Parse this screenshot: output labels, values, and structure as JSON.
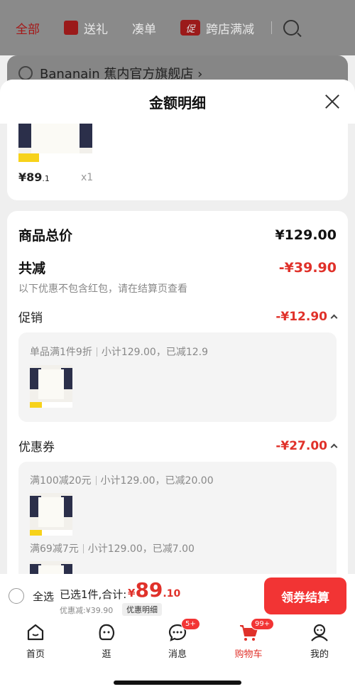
{
  "topbar": {
    "tabs": [
      "全部",
      "送礼",
      "凑单",
      "跨店满减"
    ],
    "promo_tag": "促"
  },
  "shop": {
    "name": "Bananain 蕉内官方旗舰店 ›"
  },
  "sheet": {
    "title": "金额明细",
    "item": {
      "price_int": "¥89",
      "price_dec": ".1",
      "qty": "x1"
    },
    "total_label": "商品总价",
    "total_value": "¥129.00",
    "reduce_label": "共减",
    "reduce_value": "-¥39.90",
    "reduce_note": "以下优惠不包含红包，请在结算页查看",
    "promo": {
      "label": "促销",
      "value": "-¥12.90",
      "rule": "单品满1件9折",
      "detail": "小计129.00，已减12.9"
    },
    "coupon": {
      "label": "优惠券",
      "value": "-¥27.00",
      "rules": [
        {
          "rule": "满100减20元",
          "detail": "小计129.00，已减20.00"
        },
        {
          "rule": "满69减7元",
          "detail": "小计129.00，已减7.00"
        }
      ]
    }
  },
  "checkout": {
    "select_all": "全选",
    "selected": "已选1件,合计:",
    "yen": "¥",
    "price_int": "89",
    "price_dec": ".10",
    "discount": "优惠减:¥39.90",
    "detail_btn": "优惠明细",
    "submit": "领券结算"
  },
  "tabbar": {
    "items": [
      {
        "label": "首页",
        "icon": "home-icon"
      },
      {
        "label": "逛",
        "icon": "face-icon"
      },
      {
        "label": "消息",
        "icon": "message-icon",
        "badge": "5+"
      },
      {
        "label": "购物车",
        "icon": "cart-icon",
        "badge": "99+"
      },
      {
        "label": "我的",
        "icon": "user-icon"
      }
    ]
  },
  "colors": {
    "accent": "#e0312a",
    "button": "#f23434"
  }
}
